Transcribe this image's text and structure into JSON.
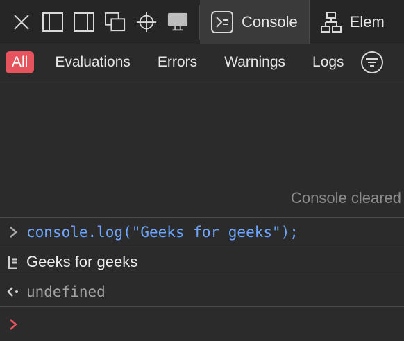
{
  "toolbar": {
    "icons": [
      "close-icon",
      "dock-left-icon",
      "dock-right-icon",
      "detach-window-icon",
      "element-picker-icon",
      "device-screen-icon"
    ],
    "tabs": [
      {
        "label": "Console",
        "icon": "console-icon",
        "active": true
      },
      {
        "label": "Elem",
        "icon": "elements-icon",
        "active": false
      }
    ]
  },
  "filters": {
    "items": [
      {
        "label": "All",
        "active": true
      },
      {
        "label": "Evaluations",
        "active": false
      },
      {
        "label": "Errors",
        "active": false
      },
      {
        "label": "Warnings",
        "active": false
      },
      {
        "label": "Logs",
        "active": false
      }
    ],
    "options_icon": "filter-options-icon",
    "accent_color": "#e5535c"
  },
  "console": {
    "cleared_message": "Console cleared",
    "input_command": "console.log(\"Geeks for geeks\");",
    "log_output": "Geeks for geeks",
    "return_value": "undefined",
    "colors": {
      "input": "#6ea6ff",
      "prompt_active": "#e5535c",
      "result": "#a3a3a3"
    }
  }
}
